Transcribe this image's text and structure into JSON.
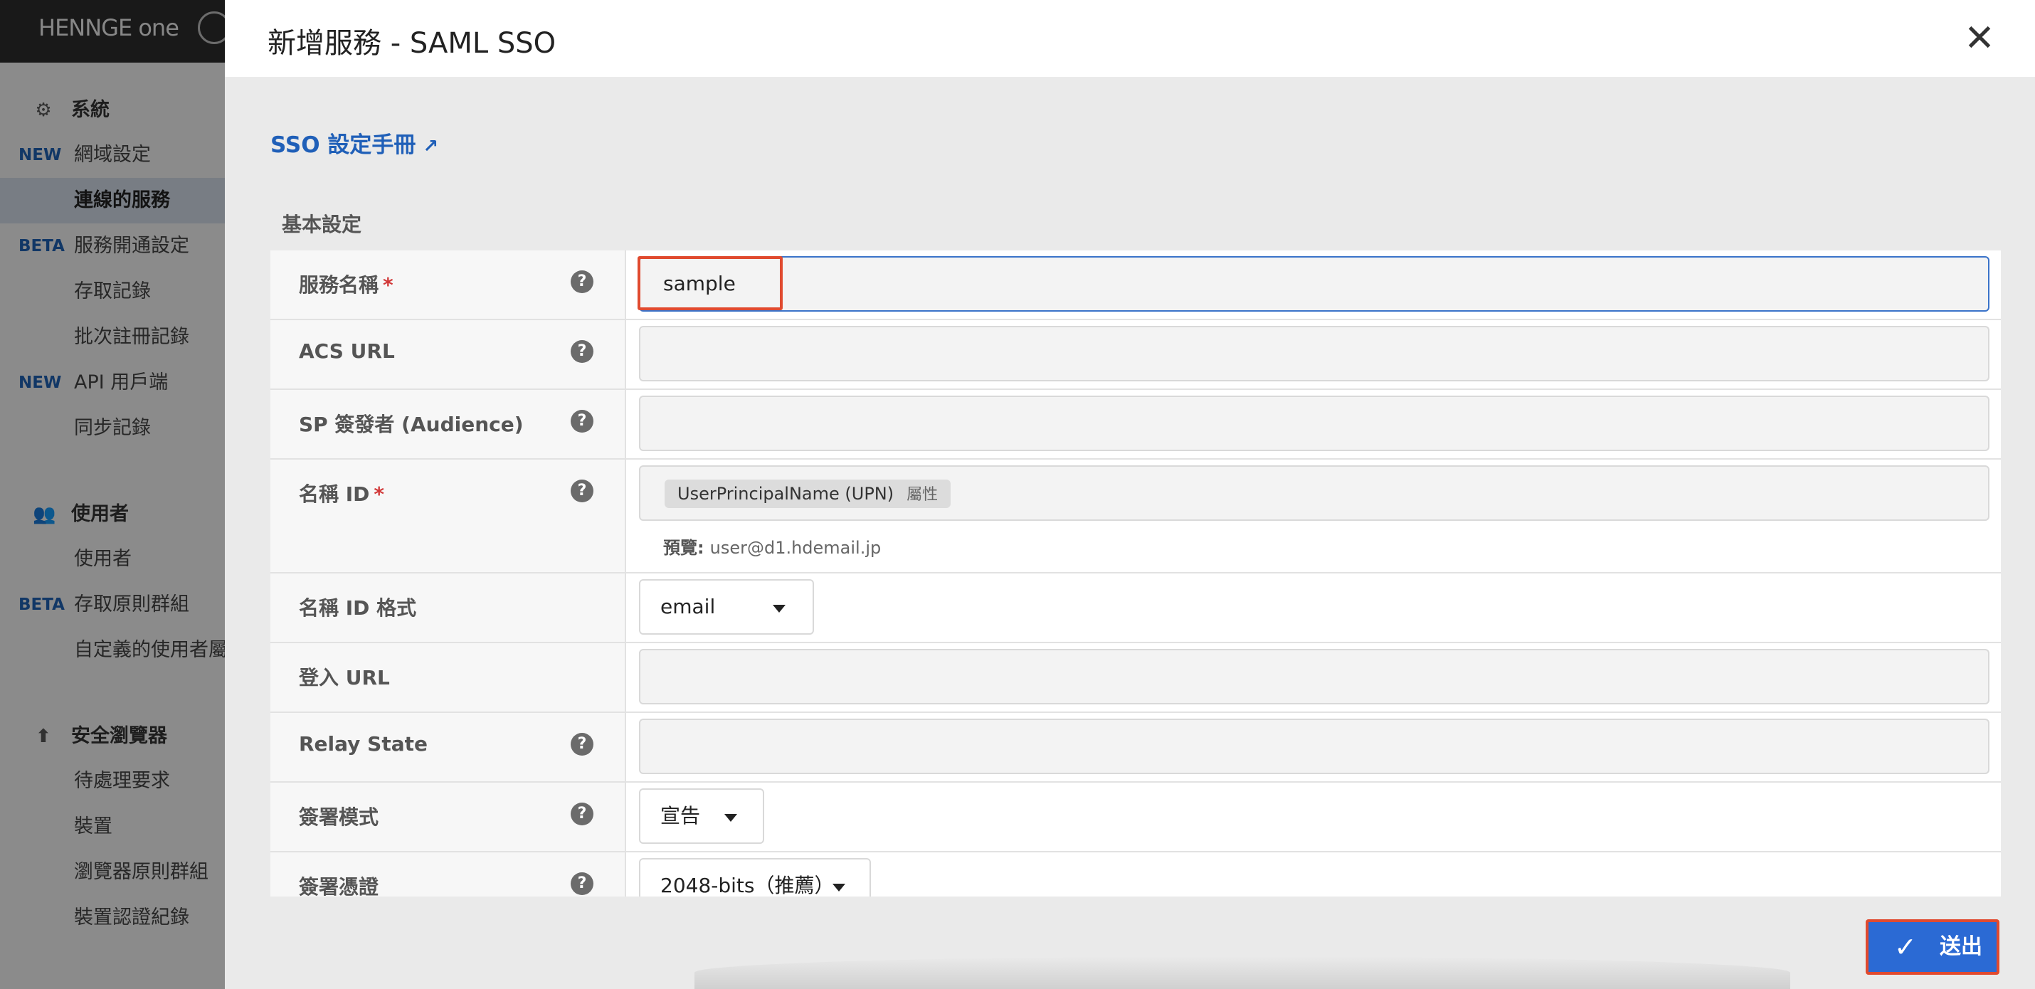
{
  "app": {
    "logo": "HENNGE one"
  },
  "sidebar": {
    "sections": [
      {
        "title": "系統",
        "icon": "gear-icon",
        "items": [
          {
            "tag": "NEW",
            "label": "網域設定",
            "active": false
          },
          {
            "tag": "",
            "label": "連線的服務",
            "active": true
          },
          {
            "tag": "BETA",
            "label": "服務開通設定",
            "active": false
          },
          {
            "tag": "",
            "label": "存取記錄",
            "active": false
          },
          {
            "tag": "",
            "label": "批次註冊記錄",
            "active": false
          },
          {
            "tag": "NEW",
            "label": "API 用戶端",
            "active": false
          },
          {
            "tag": "",
            "label": "同步記錄",
            "active": false
          }
        ]
      },
      {
        "title": "使用者",
        "icon": "users-icon",
        "items": [
          {
            "tag": "",
            "label": "使用者",
            "active": false
          },
          {
            "tag": "BETA",
            "label": "存取原則群組",
            "active": false
          },
          {
            "tag": "",
            "label": "自定義的使用者屬",
            "active": false
          }
        ]
      },
      {
        "title": "安全瀏覽器",
        "icon": "browser-upload-icon",
        "items": [
          {
            "tag": "",
            "label": "待處理要求",
            "active": false
          },
          {
            "tag": "",
            "label": "裝置",
            "active": false
          },
          {
            "tag": "",
            "label": "瀏覽器原則群組",
            "active": false
          },
          {
            "tag": "",
            "label": "裝置認證紀錄",
            "active": false
          }
        ]
      }
    ]
  },
  "modal": {
    "title": "新增服務 - SAML SSO",
    "close_icon": "close-icon",
    "manual_link": "SSO 設定手冊",
    "section_label": "基本設定",
    "fields": {
      "service_name": {
        "label": "服務名稱",
        "required": "*",
        "value": "sample"
      },
      "acs_url": {
        "label": "ACS URL",
        "value": ""
      },
      "sp_issuer": {
        "label": "SP 簽發者 (Audience)",
        "value": ""
      },
      "name_id": {
        "label": "名稱 ID",
        "required": "*",
        "chip": "UserPrincipalName (UPN)",
        "chip_attr": "屬性",
        "preview_label": "預覽:",
        "preview_value": "user@d1.hdemail.jp"
      },
      "name_id_format": {
        "label": "名稱 ID 格式",
        "value": "email"
      },
      "login_url": {
        "label": "登入 URL",
        "value": ""
      },
      "relay_state": {
        "label": "Relay State",
        "value": ""
      },
      "signing_mode": {
        "label": "簽署模式",
        "value": "宣告"
      },
      "signing_cert": {
        "label": "簽署憑證",
        "value": "2048-bits（推薦）"
      }
    },
    "submit_label": "送出",
    "colors": {
      "accent": "#2b6ad4",
      "link": "#1f5fb8",
      "highlight": "#e04a2f",
      "required": "#d13838"
    }
  }
}
